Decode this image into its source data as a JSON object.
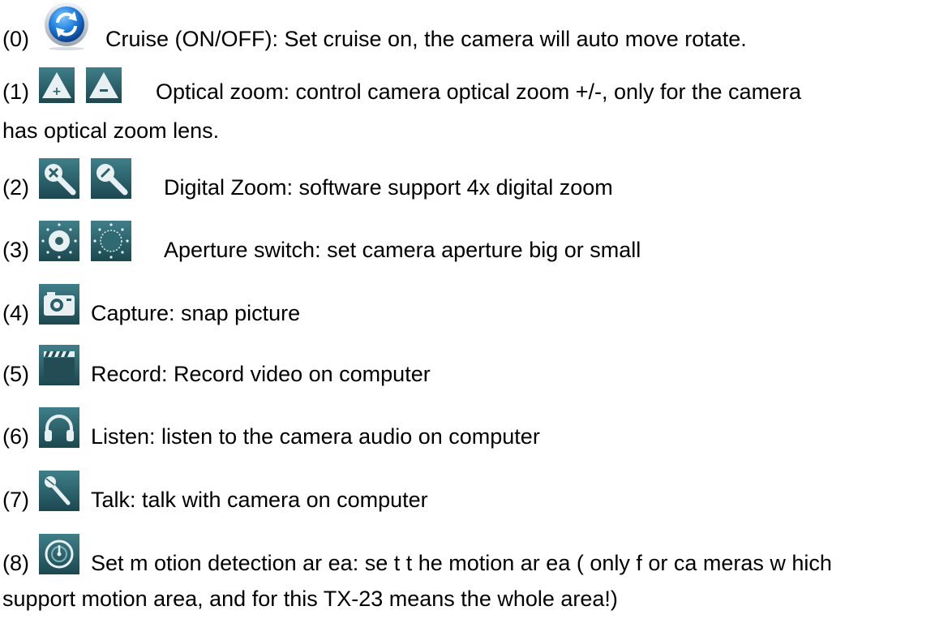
{
  "items": [
    {
      "num": "(0)",
      "icons": [
        "refresh-icon"
      ],
      "text": "Cruise (ON/OFF): Set cruise on, the camera will auto move rotate."
    },
    {
      "num": "(1)",
      "icons": [
        "zoom-in-triangle-icon",
        "zoom-out-triangle-icon"
      ],
      "text": "Optical zoom: control camera optical zoom +/-, only for the camera",
      "cont": "has optical zoom lens."
    },
    {
      "num": "(2)",
      "icons": [
        "magnifier-plus-icon",
        "magnifier-minus-icon"
      ],
      "text": "Digital Zoom: software support 4x digital zoom"
    },
    {
      "num": "(3)",
      "icons": [
        "aperture-big-icon",
        "aperture-small-icon"
      ],
      "text": "Aperture switch: set camera aperture big or small"
    },
    {
      "num": "(4)",
      "icons": [
        "camera-icon"
      ],
      "text": "Capture: snap picture"
    },
    {
      "num": "(5)",
      "icons": [
        "clapperboard-icon"
      ],
      "text": "Record: Record video on computer"
    },
    {
      "num": "(6)",
      "icons": [
        "headphones-icon"
      ],
      "text": "Listen: listen to the camera audio on computer"
    },
    {
      "num": "(7)",
      "icons": [
        "microphone-icon"
      ],
      "text": "Talk: talk with camera on computer"
    },
    {
      "num": "(8)",
      "icons": [
        "motion-area-icon"
      ],
      "text": "Set m otion  detection ar ea: se t t he  motion ar ea ( only f or ca meras w hich",
      "cont": "support motion area, and for this TX-23 means the whole area!)"
    }
  ]
}
